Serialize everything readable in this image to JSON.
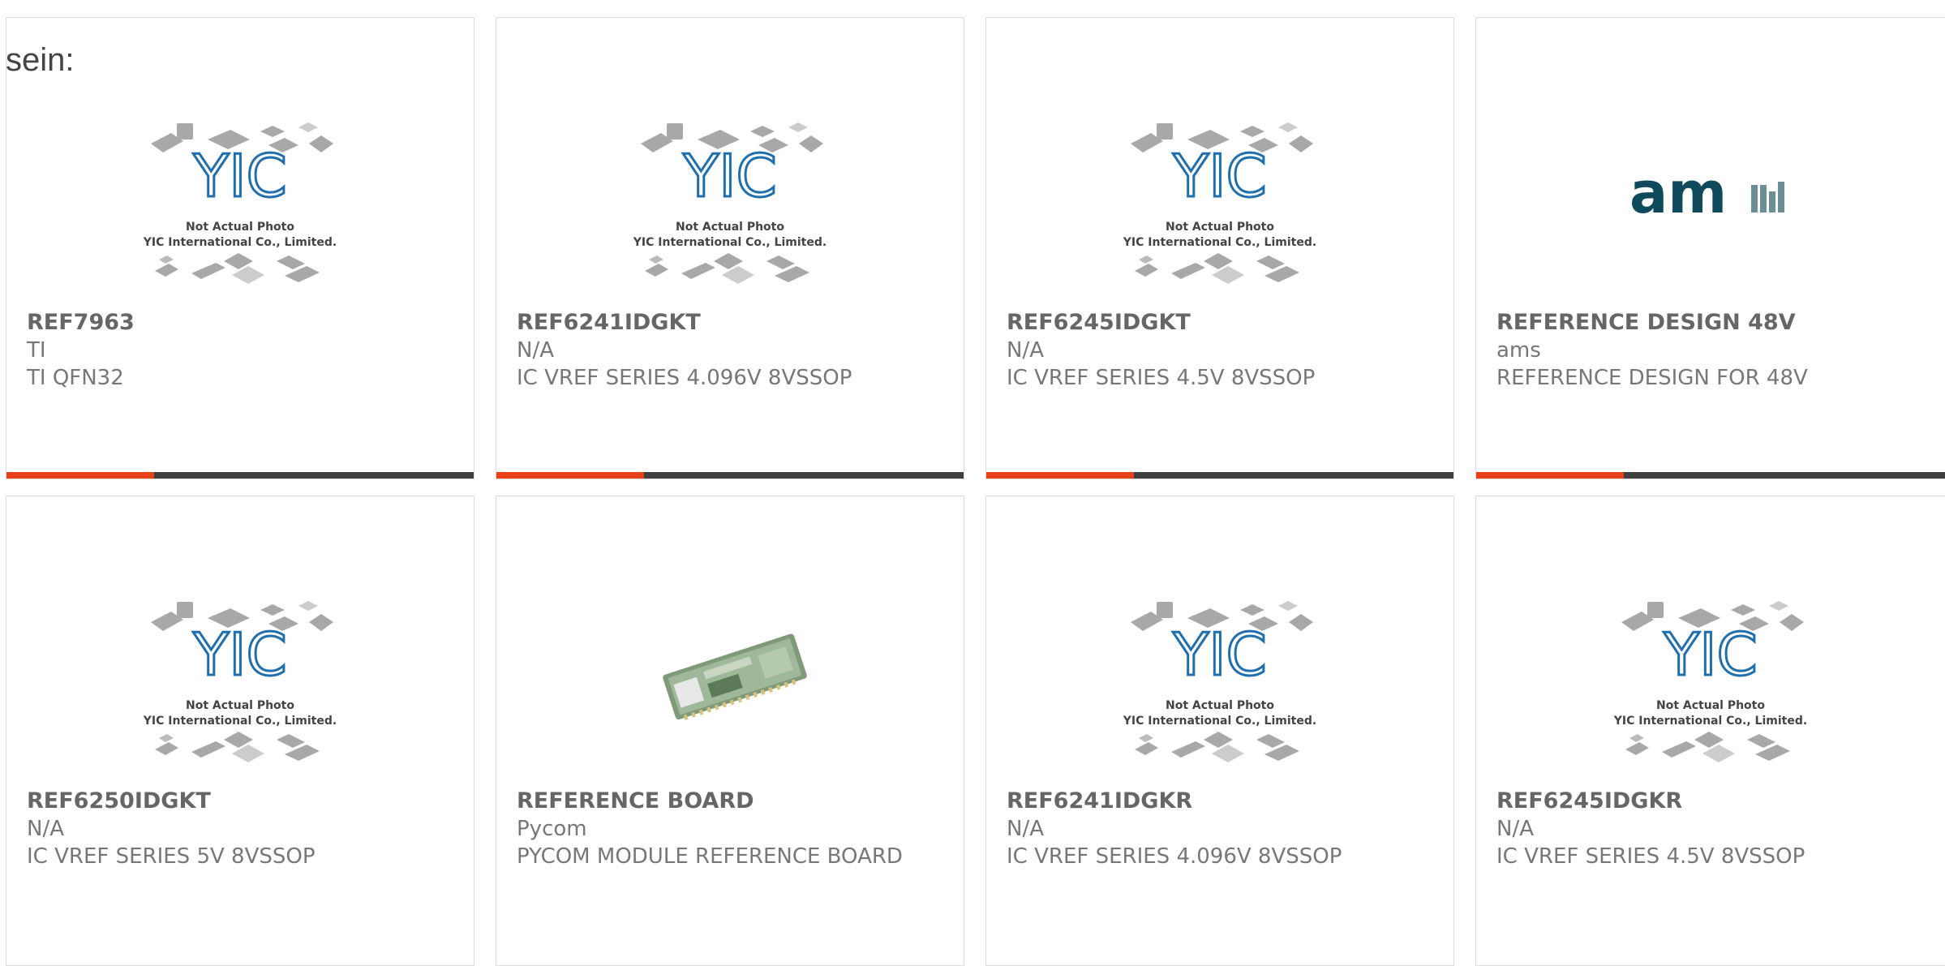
{
  "lead_text": "sein:",
  "placeholder": {
    "line1": "Not Actual Photo",
    "line2": "YIC International Co., Limited.",
    "logo": "YIC"
  },
  "brand_logo_ams": "am",
  "colors": {
    "accent": "#e8411a",
    "bar": "#3f3f3f",
    "yic_blue": "#1f6fae",
    "ams_teal": "#0f4a5c"
  },
  "products": [
    {
      "part": "REF7963",
      "manufacturer": "TI",
      "description": "TI QFN32",
      "image": "placeholder"
    },
    {
      "part": "REF6241IDGKT",
      "manufacturer": "N/A",
      "description": "IC VREF SERIES 4.096V 8VSSOP",
      "image": "placeholder"
    },
    {
      "part": "REF6245IDGKT",
      "manufacturer": "N/A",
      "description": "IC VREF SERIES 4.5V 8VSSOP",
      "image": "placeholder"
    },
    {
      "part": "REFERENCE DESIGN 48V",
      "manufacturer": "ams",
      "description": "REFERENCE DESIGN FOR 48V",
      "image": "ams-logo"
    },
    {
      "part": "REF6250IDGKT",
      "manufacturer": "N/A",
      "description": "IC VREF SERIES 5V 8VSSOP",
      "image": "placeholder"
    },
    {
      "part": "REFERENCE BOARD",
      "manufacturer": "Pycom",
      "description": "PYCOM MODULE REFERENCE BOARD",
      "image": "board-photo"
    },
    {
      "part": "REF6241IDGKR",
      "manufacturer": "N/A",
      "description": "IC VREF SERIES 4.096V 8VSSOP",
      "image": "placeholder"
    },
    {
      "part": "REF6245IDGKR",
      "manufacturer": "N/A",
      "description": "IC VREF SERIES 4.5V 8VSSOP",
      "image": "placeholder"
    }
  ]
}
